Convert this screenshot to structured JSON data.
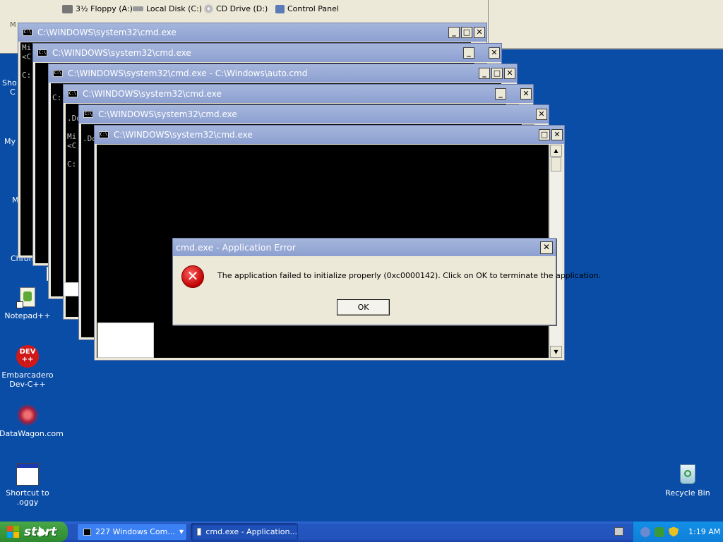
{
  "explorer": {
    "drives": [
      {
        "label": "3½ Floppy (A:)",
        "icon": "floppy-drive-icon"
      },
      {
        "label": "Local Disk (C:)",
        "icon": "hard-disk-icon"
      },
      {
        "label": "CD Drive (D:)",
        "icon": "cd-drive-icon"
      },
      {
        "label": "Control Panel",
        "icon": "control-panel-icon"
      }
    ],
    "stub": "M"
  },
  "cmd_windows": [
    {
      "title": "C:\\WINDOWS\\system32\\cmd.exe",
      "text": "Mi\n<C\n\nC:"
    },
    {
      "title": "C:\\WINDOWS\\system32\\cmd.exe",
      "text": ""
    },
    {
      "title": "C:\\WINDOWS\\system32\\cmd.exe - C:\\Windows\\auto.cmd",
      "text": "\nC:"
    },
    {
      "title": "C:\\WINDOWS\\system32\\cmd.exe",
      "text": "\n.Do\n\nMi\n<C\n\nC:"
    },
    {
      "title": "C:\\WINDOWS\\system32\\cmd.exe",
      "text": "\n.Do"
    },
    {
      "title": "C:\\WINDOWS\\system32\\cmd.exe",
      "text": ""
    }
  ],
  "dialog": {
    "title": "cmd.exe - Application Error",
    "message": "The application failed to initialize properly (0xc0000142). Click on OK to terminate the application.",
    "ok_label": "OK",
    "icon": "error-icon"
  },
  "desktop_left_labels": [
    "Sho",
    "C",
    "My",
    "M",
    "Chron"
  ],
  "desktop_icons": [
    {
      "label": "Notepad++",
      "icon": "notepad-plus-plus-icon"
    },
    {
      "label": "Embarcadero Dev-C++",
      "icon": "dev-cpp-icon",
      "badge": "DEV\n++"
    },
    {
      "label": "DataWagon.com",
      "icon": "datawagon-icon"
    },
    {
      "label": "Shortcut to .oggy",
      "icon": "oggy-shortcut-icon"
    },
    {
      "label": "Recycle Bin",
      "icon": "recycle-bin-icon"
    }
  ],
  "taskbar": {
    "start_label": "start",
    "tasks": [
      {
        "label": "227 Windows Com...",
        "icon": "cmd-icon"
      },
      {
        "label": "cmd.exe - Application...",
        "icon": "window-icon"
      }
    ],
    "clock": "1:19 AM"
  },
  "colors": {
    "desktop": "#0a4da6",
    "titlebar_inactive": "#8c9fd0",
    "taskbar": "#2354be",
    "start": "#3c9a3c"
  }
}
